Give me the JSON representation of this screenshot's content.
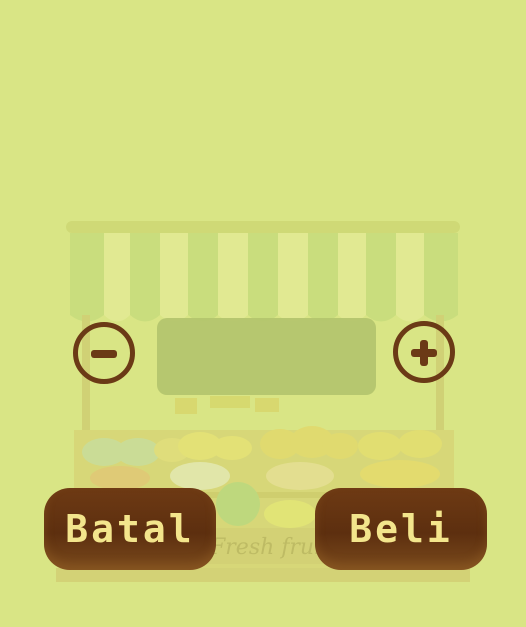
{
  "colors": {
    "background": "#d9e585",
    "accent_brown": "#6b3a16",
    "button_text": "#f3e58c",
    "display_box": "#b4c56e"
  },
  "quantity": {
    "value": "",
    "decrease_icon": "minus-icon",
    "increase_icon": "plus-icon"
  },
  "actions": {
    "cancel_label": "Batal",
    "buy_label": "Beli"
  },
  "stall": {
    "sign_text": "Fresh fruit"
  }
}
